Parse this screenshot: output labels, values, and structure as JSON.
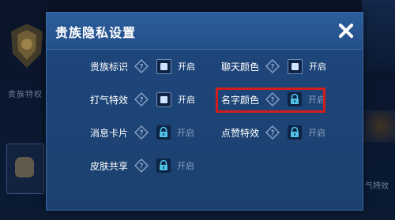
{
  "background": {
    "left_label": "贵族特权",
    "right_label": "气特效"
  },
  "dialog": {
    "title": "贵族隐私设置",
    "close_icon": "close-icon"
  },
  "settings": [
    {
      "label": "贵族标识",
      "state_label": "开启",
      "control": "checkbox",
      "checked": true,
      "locked": false
    },
    {
      "label": "聊天颜色",
      "state_label": "开启",
      "control": "checkbox",
      "checked": true,
      "locked": false
    },
    {
      "label": "打气特效",
      "state_label": "开启",
      "control": "checkbox",
      "checked": true,
      "locked": false
    },
    {
      "label": "名字颜色",
      "state_label": "开启",
      "control": "lock",
      "checked": false,
      "locked": true,
      "highlighted": true
    },
    {
      "label": "消息卡片",
      "state_label": "开启",
      "control": "lock",
      "checked": false,
      "locked": true
    },
    {
      "label": "点赞特效",
      "state_label": "开启",
      "control": "lock",
      "checked": false,
      "locked": true
    },
    {
      "label": "皮肤共享",
      "state_label": "开启",
      "control": "lock",
      "checked": false,
      "locked": true
    }
  ],
  "colors": {
    "highlight": "#d21d1d",
    "panel": "#1e467c",
    "text": "#ffffff"
  }
}
